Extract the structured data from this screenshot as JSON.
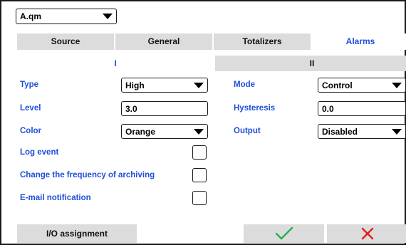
{
  "device_select": {
    "value": "A.qm"
  },
  "tabs": [
    {
      "label": "Source"
    },
    {
      "label": "General"
    },
    {
      "label": "Totalizers"
    },
    {
      "label": "Alarms"
    }
  ],
  "subtabs": [
    {
      "label": "I"
    },
    {
      "label": "II"
    }
  ],
  "form": {
    "type": {
      "label": "Type",
      "value": "High"
    },
    "level": {
      "label": "Level",
      "value": "3.0"
    },
    "color": {
      "label": "Color",
      "value": "Orange"
    },
    "log_event": {
      "label": "Log event"
    },
    "archive_freq": {
      "label": "Change the frequency of archiving"
    },
    "email": {
      "label": "E-mail notification"
    },
    "mode": {
      "label": "Mode",
      "value": "Control"
    },
    "hysteresis": {
      "label": "Hysteresis",
      "value": "0.0"
    },
    "output": {
      "label": "Output",
      "value": "Disabled"
    }
  },
  "footer": {
    "io_label": "I/O assignment",
    "confirm_icon": "check-icon",
    "cancel_icon": "close-icon",
    "confirm_color": "#22b14c",
    "cancel_color": "#e02020"
  },
  "colors": {
    "accent": "#1f4fd8",
    "tab_inactive": "#dcdcdc"
  }
}
